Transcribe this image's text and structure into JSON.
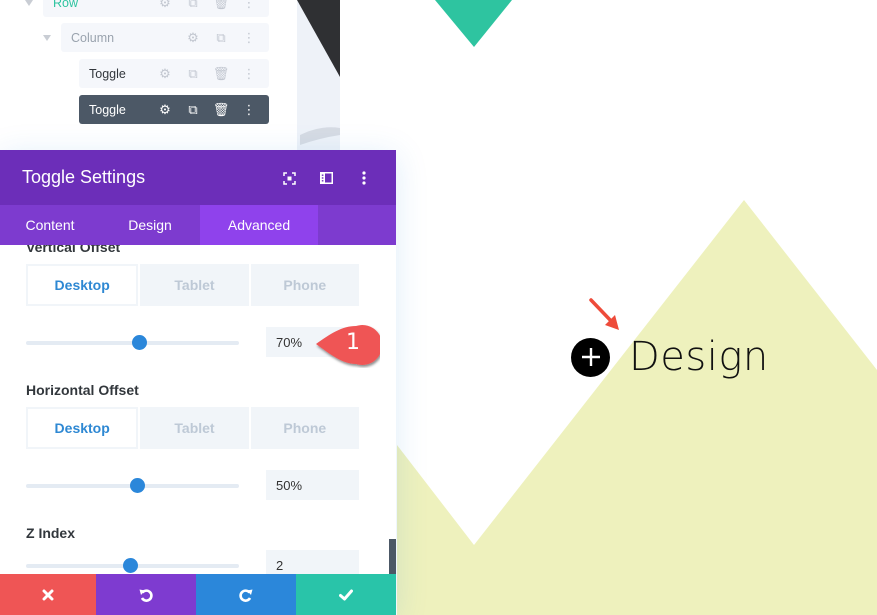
{
  "layers": {
    "items": [
      {
        "label": "Row",
        "level": "row",
        "color": "#2ec4a0",
        "icons": [
          "gear-icon",
          "duplicate-icon",
          "trash-icon",
          "more-icon"
        ]
      },
      {
        "label": "Column",
        "level": "column",
        "color": "#9aa3ae",
        "icons": [
          "gear-icon",
          "duplicate-icon",
          "more-icon"
        ]
      },
      {
        "label": "Toggle",
        "level": "module",
        "color": "#32373c",
        "icons": [
          "gear-icon",
          "duplicate-icon",
          "trash-icon",
          "more-icon"
        ]
      },
      {
        "label": "Toggle",
        "level": "module",
        "active": true,
        "color": "#ffffff",
        "icons": [
          "gear-icon",
          "duplicate-icon",
          "trash-icon",
          "more-icon"
        ]
      }
    ]
  },
  "modal": {
    "title": "Toggle Settings",
    "header_icons": [
      "expand-icon",
      "sidebar-icon",
      "more-icon"
    ],
    "tabs": [
      {
        "label": "Content",
        "active": false
      },
      {
        "label": "Design",
        "active": false
      },
      {
        "label": "Advanced",
        "active": true
      }
    ],
    "fields": {
      "vertical_offset": {
        "label": "Vertical Offset",
        "devices": [
          "Desktop",
          "Tablet",
          "Phone"
        ],
        "active_device": "Desktop",
        "value": "70%",
        "slider_fraction": 0.53
      },
      "horizontal_offset": {
        "label": "Horizontal Offset",
        "devices": [
          "Desktop",
          "Tablet",
          "Phone"
        ],
        "active_device": "Desktop",
        "value": "50%",
        "slider_fraction": 0.52
      },
      "z_index": {
        "label": "Z Index",
        "value": "2",
        "slider_fraction": 0.49
      }
    },
    "footer": {
      "cancel": {
        "icon": "close-icon",
        "color": "#ef5555"
      },
      "undo": {
        "icon": "undo-icon",
        "color": "#7e3bd0"
      },
      "redo": {
        "icon": "redo-icon",
        "color": "#2b87da"
      },
      "save": {
        "icon": "check-icon",
        "color": "#29c4a9"
      }
    }
  },
  "callout": {
    "number": "1",
    "color": "#ef5555"
  },
  "canvas": {
    "module_text": "Design",
    "colors": {
      "accent_green": "#2ec4a0",
      "shape_yellow": "#eef1bd",
      "arrow_red": "#ee4b3a"
    }
  }
}
